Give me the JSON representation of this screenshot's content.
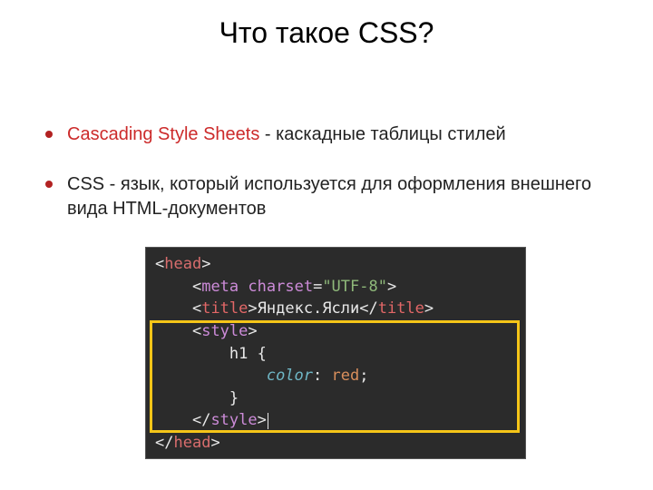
{
  "title": "Что такое CSS?",
  "bullets": [
    {
      "term": "Cascading Style Sheets",
      "rest": " - каскадные таблицы стилей"
    },
    {
      "term": "",
      "rest": "CSS - язык, который используется для оформления внешнего вида HTML-документов"
    }
  ],
  "code": {
    "head_open": "head",
    "meta_tag": "meta",
    "meta_attr": "charset",
    "meta_val": "\"UTF-8\"",
    "title_tag": "title",
    "title_text": "Яндекс.Ясли",
    "style_tag": "style",
    "selector": "h1",
    "prop": "color",
    "value": "red",
    "head_close": "head"
  }
}
